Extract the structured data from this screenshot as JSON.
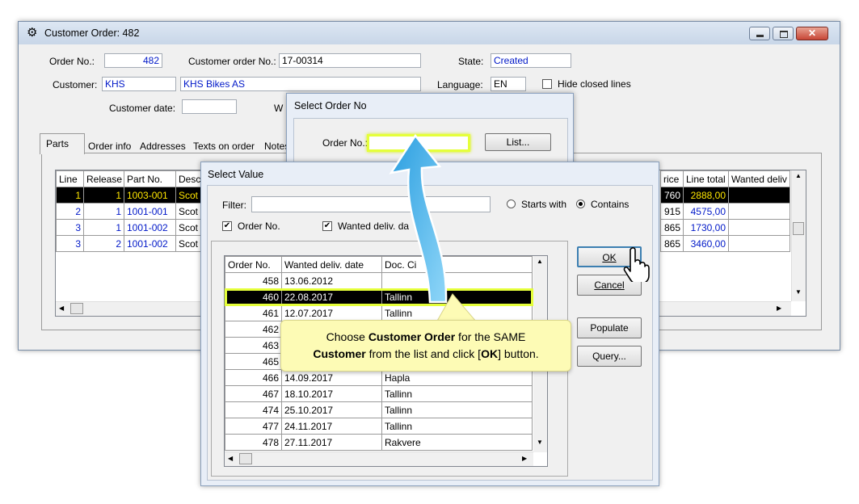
{
  "main_window": {
    "title": "Customer Order: 482",
    "order_no_label": "Order No.:",
    "order_no": "482",
    "customer_order_no_label": "Customer order No.:",
    "customer_order_no": "17-00314",
    "state_label": "State:",
    "state": "Created",
    "customer_label": "Customer:",
    "customer_code": "KHS",
    "customer_name": "KHS Bikes AS",
    "language_label": "Language:",
    "language": "EN",
    "hide_closed_lines": "Hide closed lines",
    "customer_date_label": "Customer date:",
    "customer_date": "",
    "w_label": "W",
    "tabs": [
      "Parts",
      "Order info",
      "Addresses",
      "Texts on order",
      "Notes"
    ],
    "grid_headers": [
      "Line",
      "Release",
      "Part No.",
      "Desc"
    ],
    "grid_rows": [
      [
        "1",
        "1",
        "1003-001",
        "Scot"
      ],
      [
        "2",
        "1",
        "1001-001",
        "Scot"
      ],
      [
        "3",
        "1",
        "1001-002",
        "Scot"
      ],
      [
        "3",
        "2",
        "1001-002",
        "Scot"
      ]
    ],
    "grid_right_headers": [
      "rice",
      "Line total",
      "Wanted deliv"
    ],
    "grid_right_rows": [
      [
        "760",
        "2888,00",
        ""
      ],
      [
        "915",
        "4575,00",
        ""
      ],
      [
        "865",
        "1730,00",
        ""
      ],
      [
        "865",
        "3460,00",
        ""
      ]
    ]
  },
  "select_order_dialog": {
    "title": "Select Order No",
    "order_no_label": "Order No.:",
    "list_button": "List..."
  },
  "select_value_dialog": {
    "title": "Select Value",
    "filter_label": "Filter:",
    "filter_value": "",
    "starts_with": "Starts with",
    "contains": "Contains",
    "chk_order_no": "Order No.",
    "chk_wanted": "Wanted deliv. da",
    "headers": [
      "Order No.",
      "Wanted deliv. date",
      "Doc. Ci"
    ],
    "rows": [
      [
        "458",
        "13.06.2012",
        ""
      ],
      [
        "460",
        "22.08.2017",
        "Tallinn"
      ],
      [
        "461",
        "12.07.2017",
        "Tallinn"
      ],
      [
        "462",
        "",
        ""
      ],
      [
        "463",
        "",
        ""
      ],
      [
        "465",
        "",
        ""
      ],
      [
        "466",
        "14.09.2017",
        "Hapla"
      ],
      [
        "467",
        "18.10.2017",
        "Tallinn"
      ],
      [
        "474",
        "25.10.2017",
        "Tallinn"
      ],
      [
        "477",
        "24.11.2017",
        "Tallinn"
      ],
      [
        "478",
        "27.11.2017",
        "Rakvere"
      ]
    ],
    "ok_button": "OK",
    "cancel_button": "Cancel",
    "populate_button": "Populate",
    "query_button": "Query..."
  },
  "callout": {
    "line1_pre": "Choose ",
    "line1_bold": "Customer Order",
    "line1_post": " for the SAME",
    "line2_bold": "Customer",
    "line2_mid": " from the list and click [",
    "line2_bold2": "OK",
    "line2_post": "] button."
  },
  "colors": {
    "highlight": "#e5ff3a",
    "arrow": "#49b6ea",
    "callout_bg": "#fdfbb5"
  }
}
